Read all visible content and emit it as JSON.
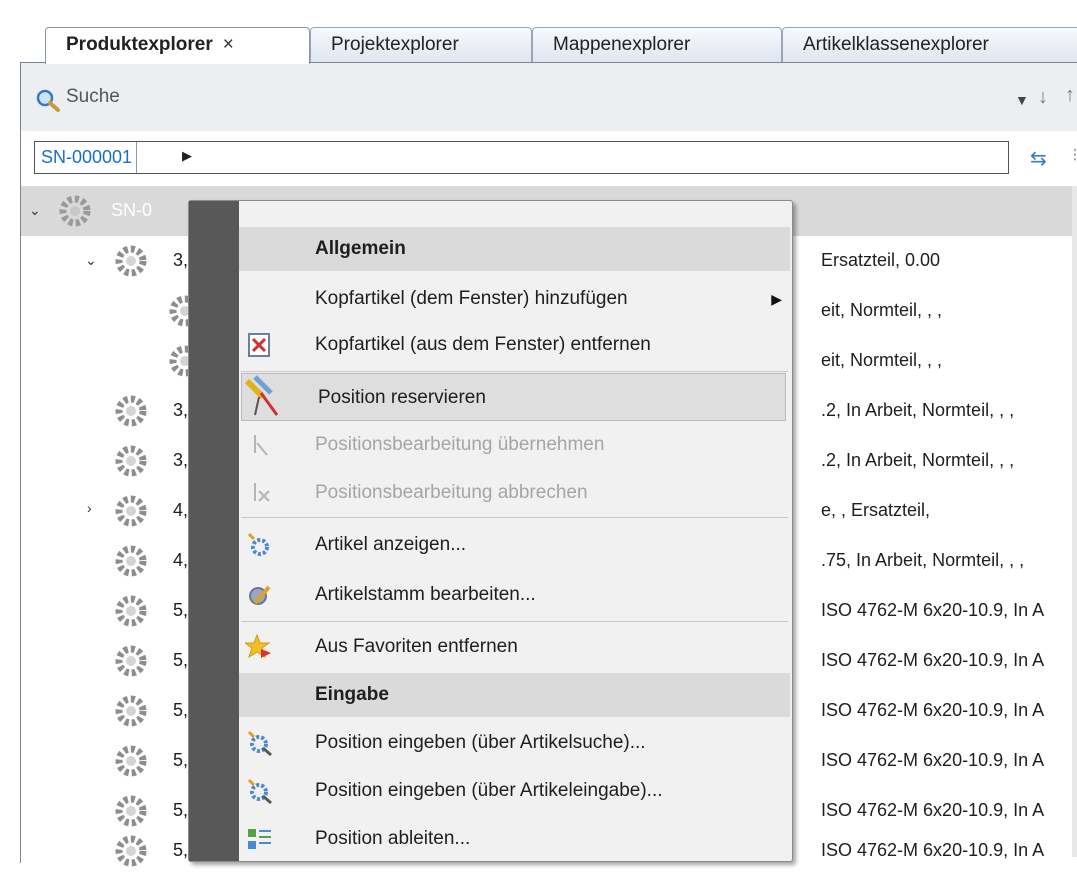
{
  "tabs": [
    {
      "label": "Produktexplorer",
      "active": true,
      "close": "×"
    },
    {
      "label": "Projektexplorer",
      "active": false
    },
    {
      "label": "Mappenexplorer",
      "active": false
    },
    {
      "label": "Artikelklassenexplorer",
      "active": false
    }
  ],
  "search": {
    "label": "Suche"
  },
  "path": {
    "crumb": "SN-000001"
  },
  "tree": {
    "root_label": "SN-0",
    "rows": [
      {
        "label": "3,",
        "detail": "Ersatzteil, 0.00"
      },
      {
        "label": "",
        "detail": "eit, Normteil, , ,"
      },
      {
        "label": "",
        "detail": "eit, Normteil, , ,"
      },
      {
        "label": "3,",
        "detail": ".2, In Arbeit, Normteil, , ,"
      },
      {
        "label": "3,",
        "detail": ".2, In Arbeit, Normteil, , ,"
      },
      {
        "label": "4,",
        "detail": "e, , Ersatzteil,"
      },
      {
        "label": "4,",
        "detail": ".75, In Arbeit, Normteil, , ,"
      },
      {
        "label": "5,",
        "detail": "ISO 4762-M 6x20-10.9, In A"
      },
      {
        "label": "5,",
        "detail": "ISO 4762-M 6x20-10.9, In A"
      },
      {
        "label": "5,",
        "detail": "ISO 4762-M 6x20-10.9, In A"
      },
      {
        "label": "5,",
        "detail": "ISO 4762-M 6x20-10.9, In A"
      },
      {
        "label": "5,",
        "detail": "ISO 4762-M 6x20-10.9, In A"
      },
      {
        "label": "5,",
        "detail": "ISO 4762-M 6x20-10.9, In A"
      }
    ]
  },
  "context_menu": {
    "header_general": "Allgemein",
    "items_general": [
      {
        "label": "Kopfartikel (dem Fenster) hinzufügen",
        "enabled": true,
        "icon": "none",
        "submenu": true
      },
      {
        "label": "Kopfartikel (aus dem Fenster) entfernen",
        "enabled": true,
        "icon": "remove-item-icon"
      },
      {
        "label": "Position reservieren",
        "enabled": true,
        "icon": "reserve-position-icon",
        "hover": true
      },
      {
        "label": "Positionsbearbeitung übernehmen",
        "enabled": false,
        "icon": "accept-edit-icon"
      },
      {
        "label": "Positionsbearbeitung abbrechen",
        "enabled": false,
        "icon": "cancel-edit-icon"
      },
      {
        "label": "Artikel anzeigen...",
        "enabled": true,
        "icon": "show-item-icon"
      },
      {
        "label": "Artikelstamm bearbeiten...",
        "enabled": true,
        "icon": "edit-master-icon"
      },
      {
        "label": "Aus Favoriten entfernen",
        "enabled": true,
        "icon": "favorite-remove-icon"
      }
    ],
    "header_input": "Eingabe",
    "items_input": [
      {
        "label": "Position eingeben (über Artikelsuche)...",
        "enabled": true,
        "icon": "enter-search-icon"
      },
      {
        "label": "Position eingeben (über Artikeleingabe)...",
        "enabled": true,
        "icon": "enter-input-icon"
      },
      {
        "label": "Position ableiten...",
        "enabled": true,
        "icon": "derive-position-icon"
      }
    ]
  }
}
